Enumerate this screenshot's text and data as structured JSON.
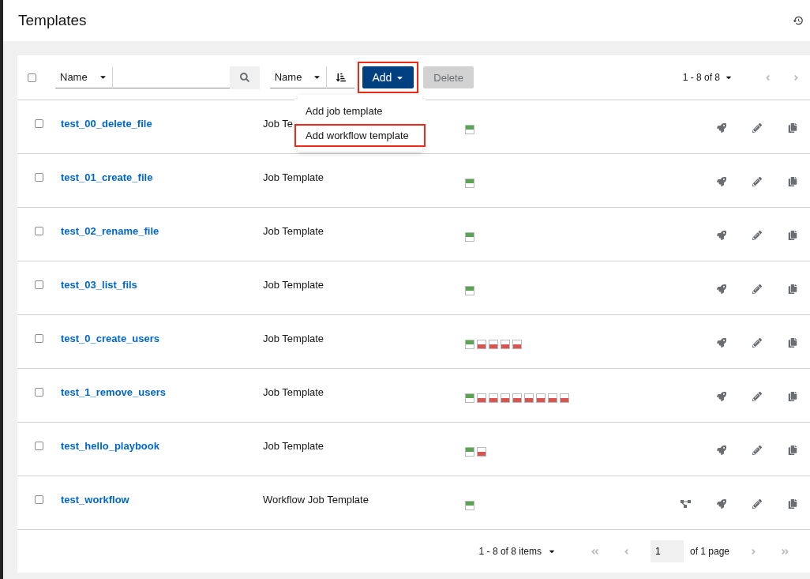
{
  "page": {
    "title": "Templates"
  },
  "toolbar": {
    "select_all_checked": false,
    "filter_field": "Name",
    "sort_field": "Name",
    "add_button": {
      "label": "Add",
      "highlighted": true
    },
    "delete_button": {
      "label": "Delete",
      "disabled": true
    },
    "range": "1 - 8 of 8"
  },
  "add_menu": [
    {
      "label": "Add job template",
      "highlighted": false
    },
    {
      "label": "Add workflow template",
      "highlighted": true
    }
  ],
  "rows": [
    {
      "name": "test_00_delete_file",
      "type": "Job Te",
      "checked": false,
      "workflow": false,
      "jobs": [
        {
          "kind": "success"
        }
      ]
    },
    {
      "name": "test_01_create_file",
      "type": "Job Template",
      "checked": false,
      "workflow": false,
      "jobs": [
        {
          "kind": "success"
        }
      ]
    },
    {
      "name": "test_02_rename_file",
      "type": "Job Template",
      "checked": false,
      "workflow": false,
      "jobs": [
        {
          "kind": "success"
        }
      ]
    },
    {
      "name": "test_03_list_fils",
      "type": "Job Template",
      "checked": false,
      "workflow": false,
      "jobs": [
        {
          "kind": "success"
        }
      ]
    },
    {
      "name": "test_0_create_users",
      "type": "Job Template",
      "checked": false,
      "workflow": false,
      "jobs": [
        {
          "kind": "success"
        },
        {
          "kind": "failed"
        },
        {
          "kind": "failed"
        },
        {
          "kind": "failed"
        },
        {
          "kind": "failed"
        }
      ]
    },
    {
      "name": "test_1_remove_users",
      "type": "Job Template",
      "checked": false,
      "workflow": false,
      "jobs": [
        {
          "kind": "success"
        },
        {
          "kind": "failed"
        },
        {
          "kind": "failed"
        },
        {
          "kind": "failed"
        },
        {
          "kind": "failed"
        },
        {
          "kind": "failed"
        },
        {
          "kind": "failed"
        },
        {
          "kind": "failed"
        },
        {
          "kind": "failed"
        }
      ]
    },
    {
      "name": "test_hello_playbook",
      "type": "Job Template",
      "checked": false,
      "workflow": false,
      "jobs": [
        {
          "kind": "success"
        },
        {
          "kind": "failed"
        }
      ]
    },
    {
      "name": "test_workflow",
      "type": "Workflow Job Template",
      "checked": false,
      "workflow": true,
      "jobs": [
        {
          "kind": "success"
        }
      ]
    }
  ],
  "pagination": {
    "items": "1 - 8 of 8 items",
    "page": "1",
    "of_pages": "of 1 page"
  }
}
